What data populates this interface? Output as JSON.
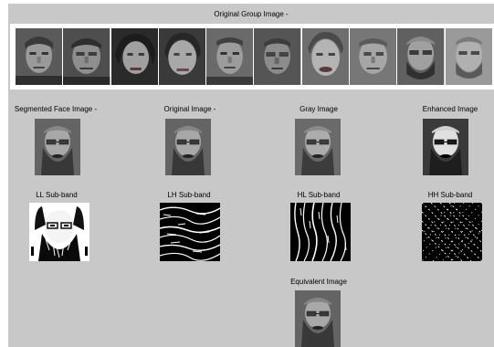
{
  "figure": {
    "group_title": "Original Group Image -",
    "panels_row1": [
      {
        "key": "segmented",
        "title": "Segmented Face Image -"
      },
      {
        "key": "original",
        "title": "Original Image -"
      },
      {
        "key": "gray",
        "title": "Gray Image"
      },
      {
        "key": "enhanced",
        "title": "Enhanced Image"
      }
    ],
    "panels_row2": [
      {
        "key": "ll",
        "title": "LL Sub-band"
      },
      {
        "key": "lh",
        "title": "LH Sub-band"
      },
      {
        "key": "hl",
        "title": "HL Sub-band"
      },
      {
        "key": "hh",
        "title": "HH Sub-band"
      }
    ],
    "equivalent_title": "Equivalent Image"
  },
  "colors": {
    "figure_bg": "#c8c8c8",
    "group_frame": "#ffffff"
  }
}
